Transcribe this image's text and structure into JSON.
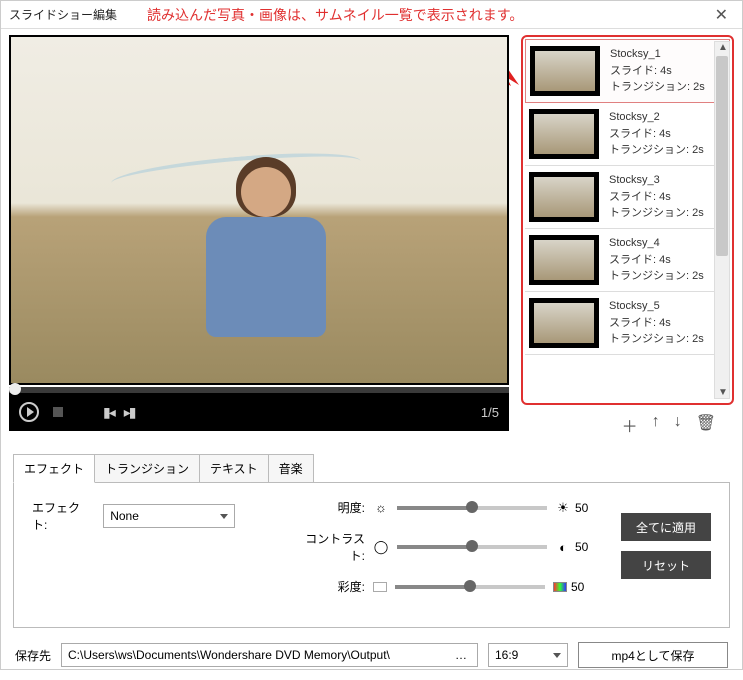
{
  "window": {
    "title": "スライドショー編集",
    "annotation": "読み込んだ写真・画像は、サムネイル一覧で表示されます。"
  },
  "player": {
    "counter": "1/5"
  },
  "thumbnails": {
    "items": [
      {
        "name": "Stocksy_1",
        "slide": "スライド: 4s",
        "transition": "トランジション: 2s"
      },
      {
        "name": "Stocksy_2",
        "slide": "スライド: 4s",
        "transition": "トランジション: 2s"
      },
      {
        "name": "Stocksy_3",
        "slide": "スライド: 4s",
        "transition": "トランジション: 2s"
      },
      {
        "name": "Stocksy_4",
        "slide": "スライド: 4s",
        "transition": "トランジション: 2s"
      },
      {
        "name": "Stocksy_5",
        "slide": "スライド: 4s",
        "transition": "トランジション: 2s"
      }
    ]
  },
  "tabs": {
    "effect": "エフェクト",
    "transition": "トランジション",
    "text": "テキスト",
    "music": "音楽"
  },
  "effect": {
    "label": "エフェクト:",
    "value": "None",
    "brightness_label": "明度:",
    "contrast_label": "コントラスト:",
    "saturation_label": "彩度:",
    "brightness_value": "50",
    "contrast_value": "50",
    "saturation_value": "50",
    "apply_all": "全てに適用",
    "reset": "リセット"
  },
  "save": {
    "label": "保存先",
    "path": "C:\\Users\\ws\\Documents\\Wondershare DVD Memory\\Output\\",
    "ratio": "16:9",
    "button": "mp4として保存"
  }
}
